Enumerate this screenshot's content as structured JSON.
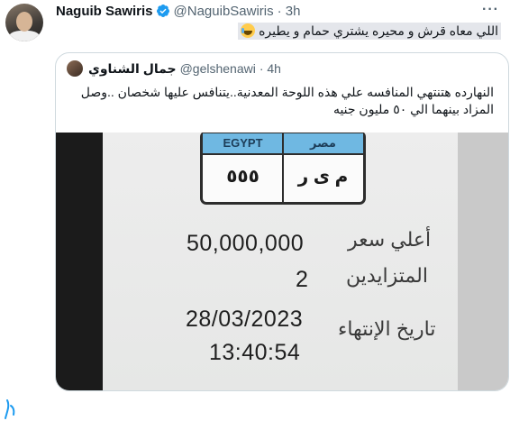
{
  "tweet": {
    "name": "Naguib Sawiris",
    "handle": "@NaguibSawiris",
    "time": "· 3h",
    "more": "···",
    "text": "اللي معاه قرش و محيره يشتري حمام و يطيره",
    "emoji": "face-with-tears-of-joy"
  },
  "quote": {
    "name": "جمال الشناوي",
    "handle": "@gelshenawi",
    "time": "· 4h",
    "text": "النهارده هتنتهي المنافسه علي هذه اللوحة المعدنية..يتنافس عليها شخصان ..وصل المزاد بينهما الي ٥٠ مليون جنيه"
  },
  "image": {
    "plate": {
      "country_en": "EGYPT",
      "country_ar": "مصر",
      "number": "٥٥٥",
      "letters": "م ى ر"
    },
    "highest_price_label": "أعلي سعر",
    "highest_price_value": "50,000,000",
    "bidders_label": "المتزايدين",
    "bidders_value": "2",
    "end_date_label": "تاريخ الإنتهاء",
    "end_date_value": "28/03/2023",
    "end_time_value": "13:40:54"
  },
  "colors": {
    "verified": "#1d9bf0",
    "plate_band": "#6fb8e2",
    "stroke": "#1d9bf0"
  }
}
